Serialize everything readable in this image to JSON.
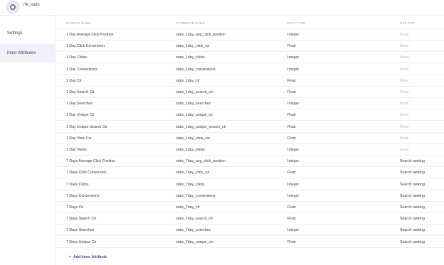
{
  "app": {
    "title": "rfk_stats"
  },
  "sidebar": {
    "items": [
      {
        "label": "Settings"
      },
      {
        "label": "Inner Attributes"
      }
    ]
  },
  "table": {
    "headers": [
      "DISPLAY NAME",
      "ATTRIBUTE NAME",
      "DATA TYPE",
      "USE FOR"
    ],
    "rows": [
      {
        "display": "1 Day Average Click Position",
        "attribute": "stats_1day_avg_click_position",
        "type": "Integer",
        "use": "None"
      },
      {
        "display": "1 Day Click Conversion",
        "attribute": "stats_1day_click_cvr",
        "type": "Float",
        "use": "None"
      },
      {
        "display": "1 Day Clicks",
        "attribute": "stats_1day_clicks",
        "type": "Integer",
        "use": "None"
      },
      {
        "display": "1 Day Conversions",
        "attribute": "stats_1day_conversions",
        "type": "Integer",
        "use": "None"
      },
      {
        "display": "1 Day Ctr",
        "attribute": "stats_1day_ctr",
        "type": "Float",
        "use": "None"
      },
      {
        "display": "1 Day Search Ctr",
        "attribute": "stats_1day_search_ctr",
        "type": "Float",
        "use": "None"
      },
      {
        "display": "1 Day Searches",
        "attribute": "stats_1day_searches",
        "type": "Integer",
        "use": "None"
      },
      {
        "display": "1 Day Unique Ctr",
        "attribute": "stats_1day_unique_ctr",
        "type": "Float",
        "use": "None"
      },
      {
        "display": "1 Day Unique Search Ctr",
        "attribute": "stats_1day_unique_search_ctr",
        "type": "Float",
        "use": "None"
      },
      {
        "display": "1 Day View Cvr",
        "attribute": "stats_1day_view_cvr",
        "type": "Float",
        "use": "None"
      },
      {
        "display": "1 Day Views",
        "attribute": "stats_1day_views",
        "type": "Integer",
        "use": "None"
      },
      {
        "display": "7 Days Average Click Position",
        "attribute": "stats_7day_avg_click_position",
        "type": "Integer",
        "use": "Search ranking"
      },
      {
        "display": "7 Days Click Conversion",
        "attribute": "stats_7day_click_cvr",
        "type": "Float",
        "use": "Search ranking"
      },
      {
        "display": "7 Days Clicks",
        "attribute": "stats_7day_clicks",
        "type": "Integer",
        "use": "Search ranking"
      },
      {
        "display": "7 Days Conversions",
        "attribute": "stats_7day_conversions",
        "type": "Integer",
        "use": "Search ranking"
      },
      {
        "display": "7 Days Ctr",
        "attribute": "stats_7day_ctr",
        "type": "Float",
        "use": "Search ranking"
      },
      {
        "display": "7 Days Search Ctr",
        "attribute": "stats_7day_search_ctr",
        "type": "Float",
        "use": "Search ranking"
      },
      {
        "display": "7 Days Searches",
        "attribute": "stats_7day_searches",
        "type": "Integer",
        "use": "Search ranking"
      },
      {
        "display": "7 Days Unique Ctr",
        "attribute": "stats_7day_unique_ctr",
        "type": "Float",
        "use": "Search ranking"
      }
    ]
  },
  "actions": {
    "add_icon": "+",
    "add_label": "Add Inner Attribute"
  }
}
